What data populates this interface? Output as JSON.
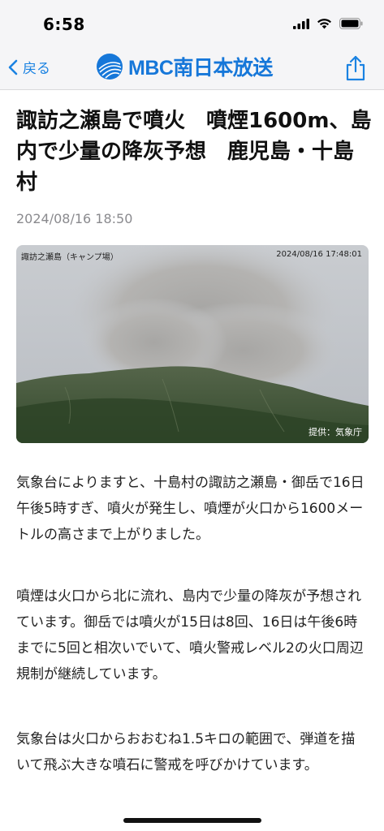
{
  "status": {
    "time": "6:58"
  },
  "nav": {
    "back_label": "戻る",
    "logo_text": "MBC南日本放送"
  },
  "article": {
    "title": "諏訪之瀬島で噴火　噴煙1600m、島内で少量の降灰予想　鹿児島・十島村",
    "date": "2024/08/16 18:50",
    "photo": {
      "camera_label": "諏訪之瀬島（キャンプ場）",
      "camera_time": "2024/08/16 17:48:01",
      "credit": "提供：気象庁"
    },
    "paragraphs": [
      "気象台によりますと、十島村の諏訪之瀬島・御岳で16日午後5時すぎ、噴火が発生し、噴煙が火口から1600メートルの高さまで上がりました。",
      "噴煙は火口から北に流れ、島内で少量の降灰が予想されています。御岳では噴火が15日は8回、16日は午後6時までに5回と相次いでいて、噴火警戒レベル2の火口周辺規制が継続しています。",
      "気象台は火口からおおむね1.5キロの範囲で、弾道を描いて飛ぶ大きな噴石に警戒を呼びかけています。"
    ]
  },
  "colors": {
    "accent": "#1a82e2",
    "brand": "#1677d9"
  }
}
